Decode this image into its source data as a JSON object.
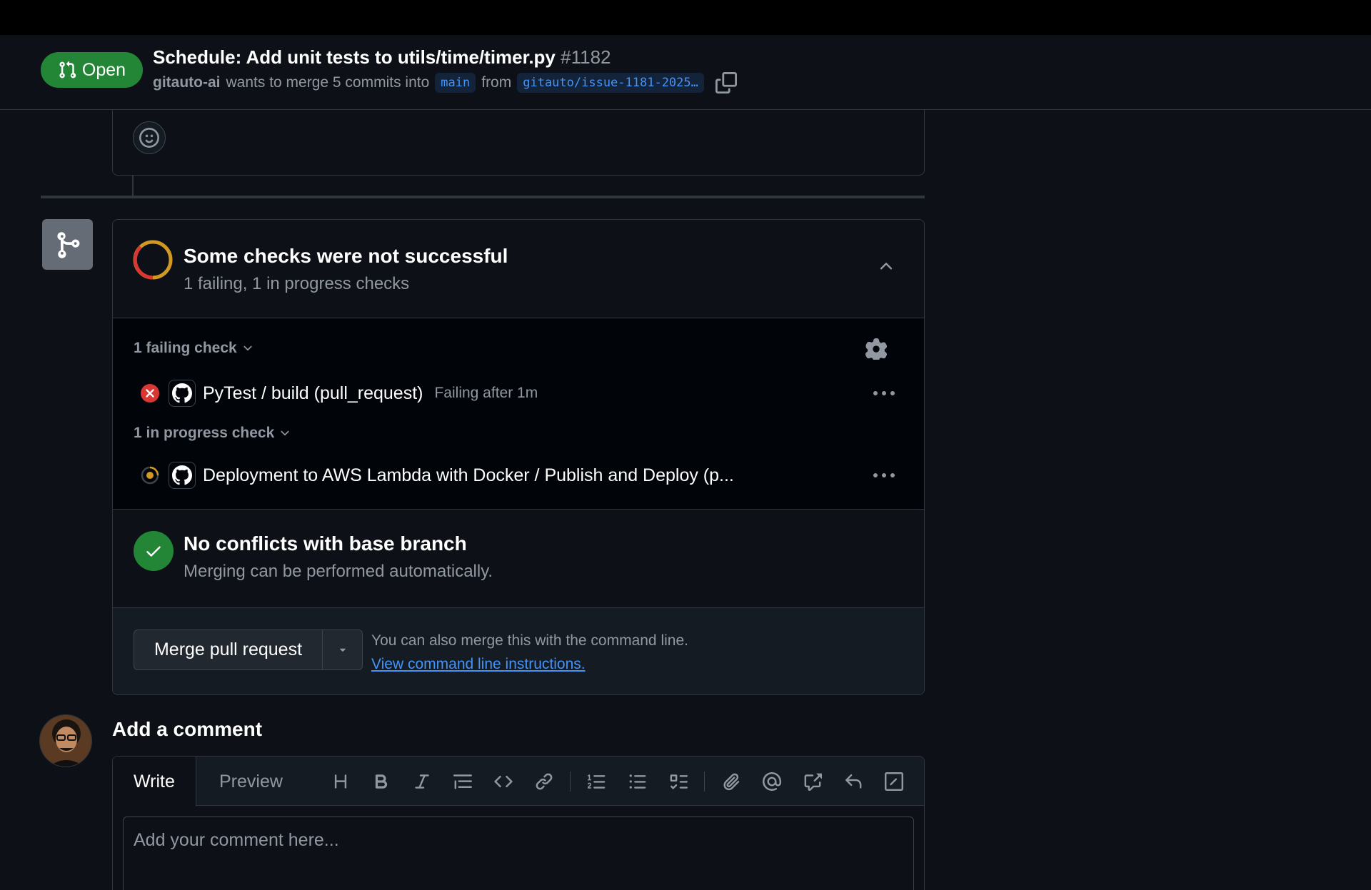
{
  "pr": {
    "state": "Open",
    "title": "Schedule: Add unit tests to utils/time/timer.py",
    "number": "#1182",
    "author": "gitauto-ai",
    "merge_text": "wants to merge 5 commits into",
    "base_branch": "main",
    "from_text": "from",
    "head_branch": "gitauto/issue-1181-2025…"
  },
  "checks": {
    "title": "Some checks were not successful",
    "subtitle": "1 failing, 1 in progress checks",
    "failing_label": "1 failing check",
    "in_progress_label": "1 in progress check",
    "failing": [
      {
        "name": "PyTest / build (pull_request)",
        "status": "Failing after 1m"
      }
    ],
    "in_progress": [
      {
        "name": "Deployment to AWS Lambda with Docker / Publish and Deploy (p...",
        "status": ""
      }
    ]
  },
  "conflicts": {
    "title": "No conflicts with base branch",
    "subtitle": "Merging can be performed automatically."
  },
  "merge": {
    "button_label": "Merge pull request",
    "cli_text": "You can also merge this with the command line.",
    "cli_link": "View command line instructions."
  },
  "comment": {
    "heading": "Add a comment",
    "tab_write": "Write",
    "tab_preview": "Preview",
    "placeholder": "Add your comment here..."
  },
  "colors": {
    "background": "#0d1117",
    "open_green": "#238636",
    "failing_red": "#da3633",
    "in_progress_amber": "#d29922",
    "link_blue": "#4493f8"
  }
}
